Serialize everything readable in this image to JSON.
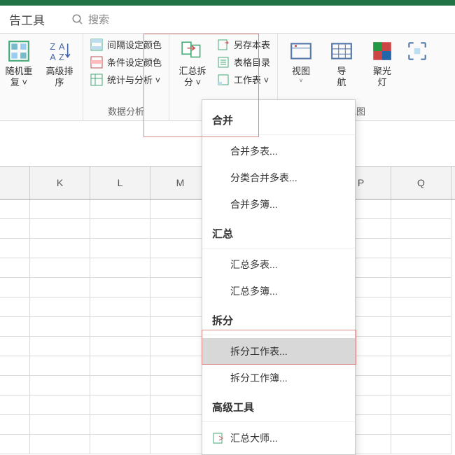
{
  "titlebar": {
    "color": "#217346"
  },
  "tabrow": {
    "tab_fragment": "告工具",
    "search_placeholder": "搜索"
  },
  "ribbon": {
    "group1": {
      "btn_random": {
        "l1": "随机重",
        "l2": "复 ˅"
      },
      "btn_advsort": {
        "l1": "高级排",
        "l2": "序"
      }
    },
    "group2": {
      "title": "数据分析",
      "item_interval": "间隔设定颜色",
      "item_cond": "条件设定颜色",
      "item_stats": "统计与分析 ˅"
    },
    "group3": {
      "btn_summary": {
        "l1": "汇总拆",
        "l2": "分 ˅"
      },
      "item_saveas": "另存本表",
      "item_toc": "表格目录",
      "item_sheet": "工作表 ˅"
    },
    "group4": {
      "title": "视图",
      "btn_view": "视图",
      "btn_nav": {
        "l1": "导",
        "l2": "航"
      },
      "btn_spot": {
        "l1": "聚光",
        "l2": "灯"
      }
    }
  },
  "columns": [
    "K",
    "L",
    "M",
    "",
    "",
    "P",
    "Q"
  ],
  "menu": {
    "sect1": "合并",
    "items1": [
      "合并多表...",
      "分类合并多表...",
      "合并多簿..."
    ],
    "sect2": "汇总",
    "items2": [
      "汇总多表...",
      "汇总多簿..."
    ],
    "sect3": "拆分",
    "items3": [
      "拆分工作表...",
      "拆分工作簿..."
    ],
    "sect4": "高级工具",
    "items4": [
      "汇总大师..."
    ]
  }
}
